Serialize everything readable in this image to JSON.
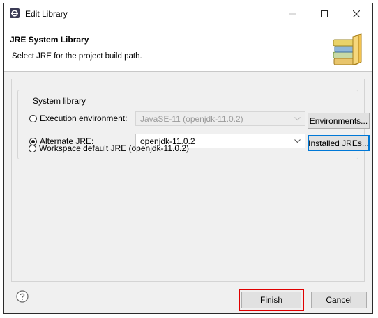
{
  "window": {
    "title": "Edit Library",
    "controls": {
      "minimize": "minimize-icon",
      "maximize": "maximize-icon",
      "close": "close-icon"
    }
  },
  "header": {
    "title": "JRE System Library",
    "description": "Select JRE for the project build path.",
    "icon": "library-books-icon"
  },
  "group": {
    "legend": "System library",
    "options": [
      {
        "label_prefix": "",
        "label_mnemonic": "E",
        "label_rest": "xecution environment:",
        "checked": false
      },
      {
        "label": "Alternate JRE:",
        "checked": true
      },
      {
        "label": "Workspace default JRE (openjdk-11.0.2)",
        "checked": false
      }
    ],
    "execution_env_combo": {
      "value": "JavaSE-11 (openjdk-11.0.2)",
      "disabled": true
    },
    "alternate_jre_combo": {
      "value": "openjdk-11.0.2",
      "disabled": false
    },
    "environments_button": {
      "prefix": "Enviro",
      "mnemonic": "n",
      "suffix": "ments..."
    },
    "installed_jres_button": "Installed JREs..."
  },
  "footer": {
    "help_icon": "help-icon",
    "finish": "Finish",
    "cancel": "Cancel"
  },
  "colors": {
    "accent": "#0078d7",
    "highlight": "#e00000"
  }
}
